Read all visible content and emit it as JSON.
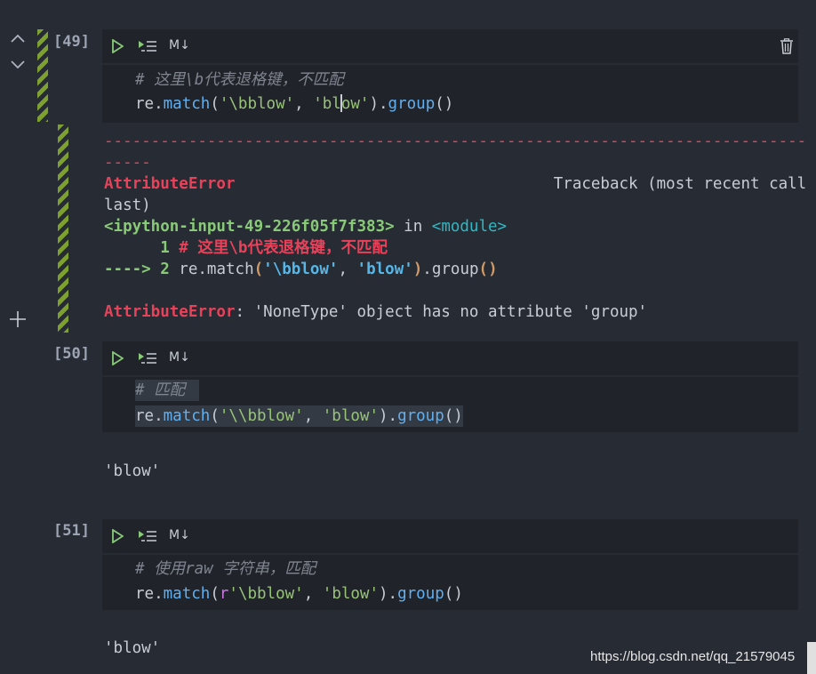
{
  "gutter": {
    "up_icon": "chevron-up-icon",
    "down_icon": "chevron-down-icon",
    "add_icon": "plus-icon"
  },
  "toolbar": {
    "run_icon": "play-icon",
    "run_below_icon": "run-below-icon",
    "markdown_label": "M↓",
    "delete_icon": "trash-icon"
  },
  "cells": [
    {
      "prompt": "[49]",
      "code_line1": "# 这里\\b代表退格键，不匹配",
      "code_line2_parts": [
        "re",
        ".",
        "match",
        "(",
        "'\\bblow'",
        ", ",
        "'bl",
        "ow'",
        ")",
        ".",
        "group",
        "()"
      ],
      "traceback": {
        "dashes1": "---------------------------------------------------------------------------",
        "dashes2": "-----",
        "error_name": "AttributeError",
        "traceback_label": "Traceback (most recent call",
        "traceback_label2": "last)",
        "input_ref": "<ipython-input-49-226f05f7f383>",
        "in_word": " in ",
        "module": "<module>",
        "line1_num": "      1 ",
        "line1_text": "# 这里\\b代表退格键，不匹配",
        "arrow": "----> ",
        "line2_num": "2 ",
        "line2_re": "re",
        "line2_dot": ".",
        "line2_match": "match",
        "line2_paren_open": "(",
        "line2_str1": "'\\bblow'",
        "line2_comma": ", ",
        "line2_str2": "'blow'",
        "line2_paren_close": ")",
        "line2_dot2": ".",
        "line2_group": "group",
        "line2_parens": "()",
        "final_error": "AttributeError",
        "final_message": ": 'NoneType' object has no attribute 'group'"
      }
    },
    {
      "prompt": "[50]",
      "code_line1": "# 匹配",
      "code_line2_parts": [
        "re",
        ".",
        "match",
        "(",
        "'\\\\bblow'",
        ", ",
        "'blow'",
        ")",
        ".",
        "group",
        "()"
      ],
      "output": "'blow'"
    },
    {
      "prompt": "[51]",
      "code_line1": "# 使用raw 字符串，匹配",
      "code_line2_parts": [
        "re",
        ".",
        "match",
        "(",
        "r",
        "'\\bblow'",
        ", ",
        "'blow'",
        ")",
        ".",
        "group",
        "()"
      ],
      "output": "'blow'"
    }
  ],
  "watermark": "https://blog.csdn.net/qq_21579045"
}
